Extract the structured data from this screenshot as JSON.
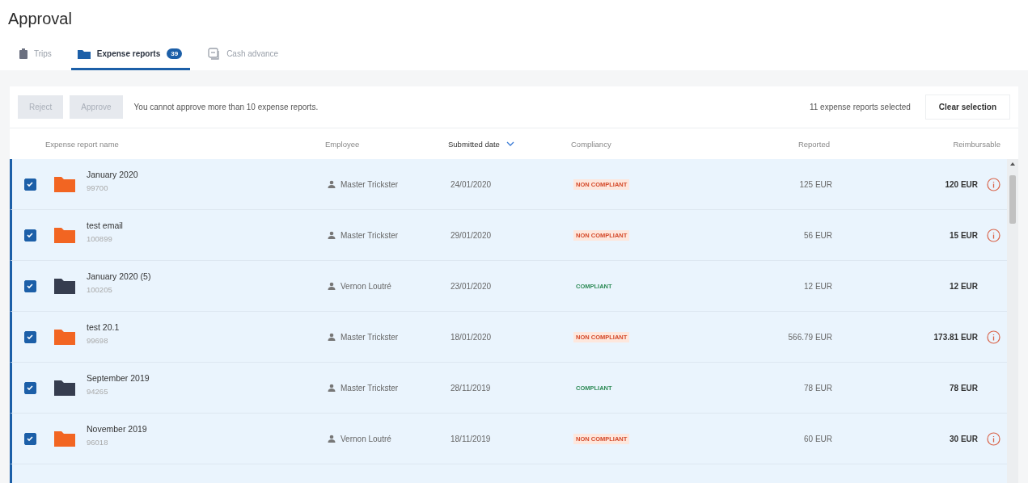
{
  "title": "Approval",
  "tabs": [
    {
      "label": "Trips",
      "selected": false
    },
    {
      "label": "Expense reports",
      "badge": "39",
      "selected": true
    },
    {
      "label": "Cash advance",
      "selected": false
    }
  ],
  "toolbar": {
    "buttons": [
      {
        "label": "Reject",
        "disabled": true
      },
      {
        "label": "Approve",
        "disabled": true
      }
    ],
    "message": "You cannot approve more than 10 expense reports.",
    "selection_count": "11 expense reports selected",
    "clear_button": "Clear selection"
  },
  "table": {
    "columns": [
      {
        "label": "Expense report name",
        "sorted": false
      },
      {
        "label": "Employee",
        "sorted": false
      },
      {
        "label": "Submitted date",
        "sorted": true
      },
      {
        "label": "Compliancy",
        "sorted": false
      },
      {
        "label": "Reported",
        "sorted": false
      },
      {
        "label": "Reimbursable",
        "sorted": false
      }
    ],
    "rows": [
      {
        "selected": true,
        "checked": true,
        "color": "#f26522",
        "name": "January 2020",
        "number": "99700",
        "employee": "Master Trickster",
        "date": "24/01/2020",
        "compliancy": {
          "kind": "non_compliant",
          "label": "NON COMPLIANT"
        },
        "reported": "125 EUR",
        "reimbursable": "120 EUR",
        "warning": true
      },
      {
        "selected": true,
        "checked": true,
        "color": "#f26522",
        "name": "test email",
        "number": "100899",
        "employee": "Master Trickster",
        "date": "29/01/2020",
        "compliancy": {
          "kind": "non_compliant",
          "label": "NON COMPLIANT"
        },
        "reported": "56 EUR",
        "reimbursable": "15 EUR",
        "warning": true
      },
      {
        "selected": true,
        "checked": true,
        "color": "#363d4f",
        "name": "January 2020 (5)",
        "number": "100205",
        "employee": "Vernon Loutré",
        "date": "23/01/2020",
        "compliancy": {
          "kind": "compliant",
          "label": "COMPLIANT"
        },
        "reported": "12 EUR",
        "reimbursable": "12 EUR",
        "warning": false
      },
      {
        "selected": true,
        "checked": true,
        "color": "#f26522",
        "name": "test 20.1",
        "number": "99698",
        "employee": "Master Trickster",
        "date": "18/01/2020",
        "compliancy": {
          "kind": "non_compliant",
          "label": "NON COMPLIANT"
        },
        "reported": "566.79 EUR",
        "reimbursable": "173.81 EUR",
        "warning": true
      },
      {
        "selected": true,
        "checked": true,
        "color": "#363d4f",
        "name": "September 2019",
        "number": "94265",
        "employee": "Master Trickster",
        "date": "28/11/2019",
        "compliancy": {
          "kind": "compliant",
          "label": "COMPLIANT"
        },
        "reported": "78 EUR",
        "reimbursable": "78 EUR",
        "warning": false
      },
      {
        "selected": true,
        "checked": true,
        "color": "#f26522",
        "name": "November 2019",
        "number": "96018",
        "employee": "Vernon Loutré",
        "date": "18/11/2019",
        "compliancy": {
          "kind": "non_compliant",
          "label": "NON COMPLIANT"
        },
        "reported": "60 EUR",
        "reimbursable": "30 EUR",
        "warning": true
      }
    ]
  }
}
